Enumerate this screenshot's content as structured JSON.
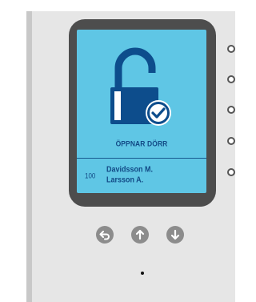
{
  "display": {
    "status_text": "ÖPPNAR DÖRR",
    "room_number": "100",
    "residents": [
      "Davidsson M.",
      "Larsson A."
    ],
    "main_icon": "unlocked-padlock-with-check-icon"
  },
  "nav_buttons": [
    {
      "icon": "back-arrow-icon"
    },
    {
      "icon": "arrow-up-icon"
    },
    {
      "icon": "arrow-down-icon"
    }
  ],
  "side_indicators": 5,
  "colors": {
    "screen_background": "#5fc6e5",
    "text": "#124a86",
    "bezel": "#4d4d4d",
    "panel": "#e6e6e6",
    "button": "#8c8c8c"
  }
}
